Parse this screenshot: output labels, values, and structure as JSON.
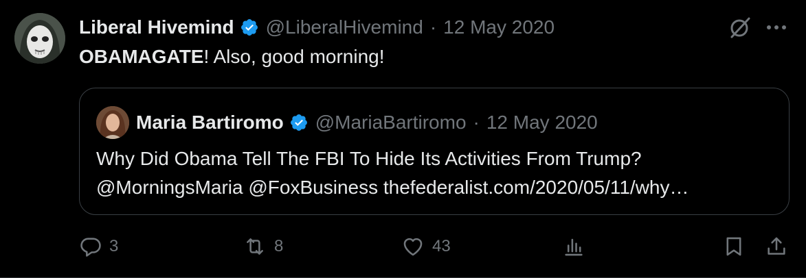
{
  "author": {
    "display_name": "Liberal Hivemind",
    "handle": "@LiberalHivemind",
    "separator": "·",
    "date": "12 May 2020"
  },
  "tweet": {
    "bold_text": "OBAMAGATE",
    "rest_text": "! Also, good morning!"
  },
  "quoted": {
    "display_name": "Maria Bartiromo",
    "handle": "@MariaBartiromo",
    "separator": "·",
    "date": "12 May 2020",
    "line1": "Why Did Obama Tell The FBI To Hide Its Activities From Trump?",
    "line2": "@MorningsMaria @FoxBusiness  thefederalist.com/2020/05/11/why…"
  },
  "actions": {
    "reply_count": "3",
    "retweet_count": "8",
    "like_count": "43"
  },
  "icons": {
    "verified": "verified-badge-icon",
    "grok": "grok-icon",
    "more": "more-dots-icon",
    "reply": "reply-icon",
    "retweet": "retweet-icon",
    "like": "heart-icon",
    "views": "views-icon",
    "bookmark": "bookmark-icon",
    "share": "share-icon"
  },
  "colors": {
    "background": "#000000",
    "text": "#e7e9ea",
    "muted": "#71767b",
    "verified": "#1d9bf0",
    "border": "#3a3f44"
  }
}
